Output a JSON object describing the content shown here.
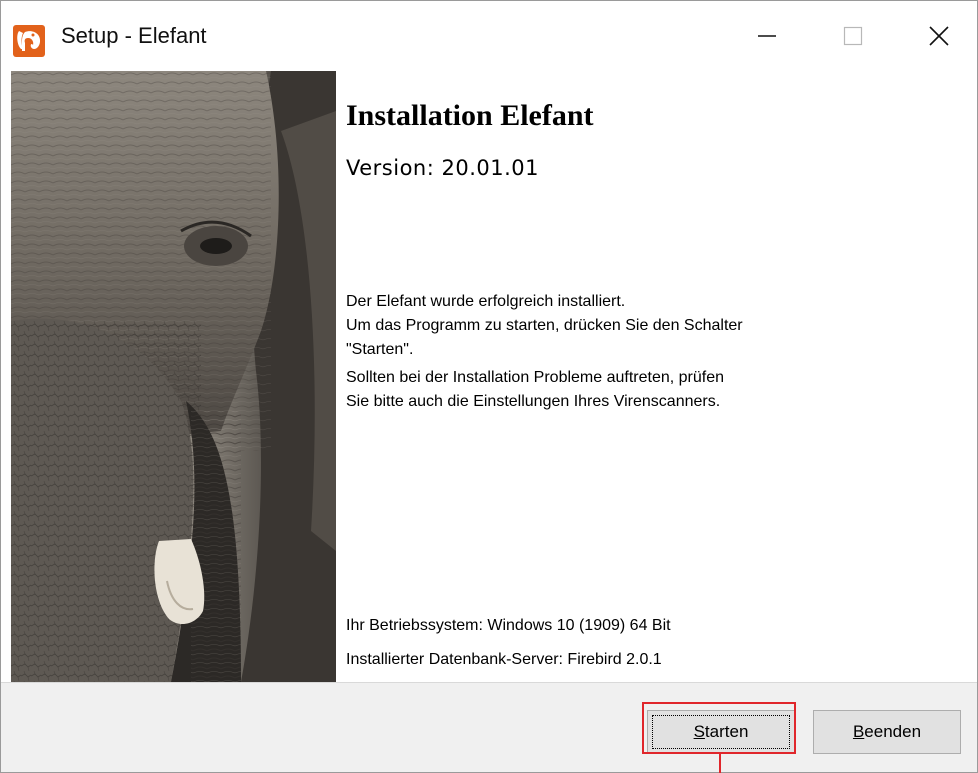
{
  "window": {
    "title": "Setup - Elefant",
    "icon": "elephant-app-icon",
    "controls": [
      "minimize-icon",
      "maximize-icon",
      "close-icon"
    ]
  },
  "sidebar": {
    "image": "elephant-photo"
  },
  "content": {
    "heading": "Installation Elefant",
    "version": "Version: 20.01.01",
    "message_lines": [
      "Der Elefant wurde erfolgreich installiert.",
      "Um das Programm zu starten, drücken Sie den Schalter",
      "\"Starten\".",
      "Sollten bei der Installation Probleme auftreten, prüfen",
      "Sie bitte auch die Einstellungen Ihres Virenscanners."
    ],
    "os_info": "Ihr Betriebssystem: Windows 10 (1909) 64 Bit",
    "db_info": "Installierter Datenbank-Server: Firebird 2.0.1"
  },
  "buttons": {
    "start": {
      "accel": "S",
      "rest": "tarten"
    },
    "end": {
      "accel": "B",
      "rest": "eenden"
    }
  },
  "colors": {
    "highlight": "#e0262b",
    "footer_bg": "#f0f0f0",
    "button_bg": "#e1e1e1"
  }
}
